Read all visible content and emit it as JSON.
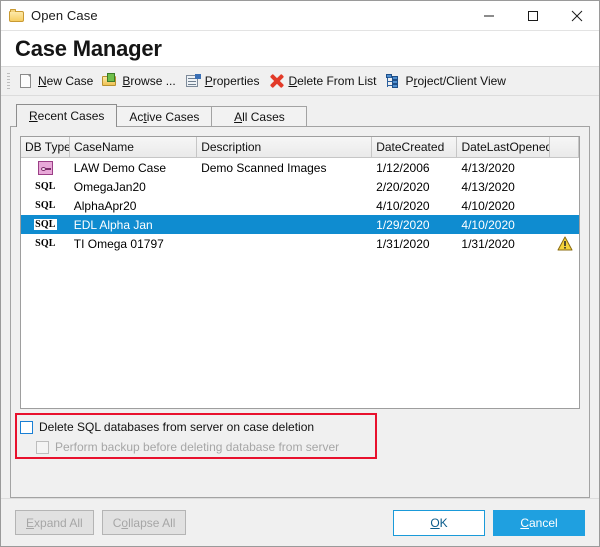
{
  "window": {
    "title": "Open Case",
    "icon": "folder-icon",
    "controls": {
      "minimize": "minimize-icon",
      "maximize": "maximize-icon",
      "close": "close-icon"
    }
  },
  "header": {
    "app_title": "Case Manager"
  },
  "toolbar": {
    "items": [
      {
        "label": "New Case",
        "accel": "N",
        "icon": "new-page-icon"
      },
      {
        "label": "Browse ...",
        "accel": "B",
        "icon": "browse-folder-icon"
      },
      {
        "label": "Properties",
        "accel": "P",
        "icon": "properties-icon"
      },
      {
        "label": "Delete From List",
        "accel": "D",
        "icon": "delete-x-icon"
      },
      {
        "label": "Project/Client View",
        "accel": "r",
        "icon": "tree-view-icon"
      }
    ]
  },
  "tabs": [
    {
      "label": "Recent Cases",
      "accel": "R",
      "active": true
    },
    {
      "label": "Active Cases",
      "accel": "t",
      "active": false
    },
    {
      "label": "All Cases",
      "accel": "A",
      "active": false
    }
  ],
  "grid": {
    "columns": [
      "DB Type",
      "CaseName",
      "Description",
      "DateCreated",
      "DateLastOpened",
      ""
    ],
    "rows": [
      {
        "db_type": "LAW",
        "db_icon": "law-key-icon",
        "case_name": "LAW Demo Case",
        "description": "Demo Scanned Images",
        "date_created": "1/12/2006",
        "date_last_opened": "4/13/2020",
        "warning": false,
        "selected": false
      },
      {
        "db_type": "SQL",
        "db_icon": "sql-text-icon",
        "case_name": "OmegaJan20",
        "description": "",
        "date_created": "2/20/2020",
        "date_last_opened": "4/13/2020",
        "warning": false,
        "selected": false
      },
      {
        "db_type": "SQL",
        "db_icon": "sql-text-icon",
        "case_name": "AlphaApr20",
        "description": "",
        "date_created": "4/10/2020",
        "date_last_opened": "4/10/2020",
        "warning": false,
        "selected": false
      },
      {
        "db_type": "SQL",
        "db_icon": "sql-text-icon",
        "case_name": "EDL Alpha Jan",
        "description": "",
        "date_created": "1/29/2020",
        "date_last_opened": "4/10/2020",
        "warning": false,
        "selected": true
      },
      {
        "db_type": "SQL",
        "db_icon": "sql-text-icon",
        "case_name": "TI Omega 01797",
        "description": "",
        "date_created": "1/31/2020",
        "date_last_opened": "1/31/2020",
        "warning": true,
        "selected": false
      }
    ]
  },
  "options": {
    "delete_sql_label": "Delete SQL databases from server on case deletion",
    "delete_sql_checked": false,
    "perform_backup_label": "Perform backup before deleting database from server",
    "perform_backup_checked": false,
    "perform_backup_disabled": true,
    "highlight_color": "#e8112d"
  },
  "footer": {
    "expand_all": "Expand All",
    "expand_all_accel": "E",
    "collapse_all": "Collapse All",
    "collapse_all_accel": "o",
    "ok": "OK",
    "ok_accel": "O",
    "cancel": "Cancel",
    "cancel_accel": "C"
  },
  "colors": {
    "selection_blue": "#0f8cd0",
    "cancel_blue": "#1fa0e0",
    "ok_border_blue": "#1a9ad9",
    "warning_yellow": "#f5d33a"
  }
}
